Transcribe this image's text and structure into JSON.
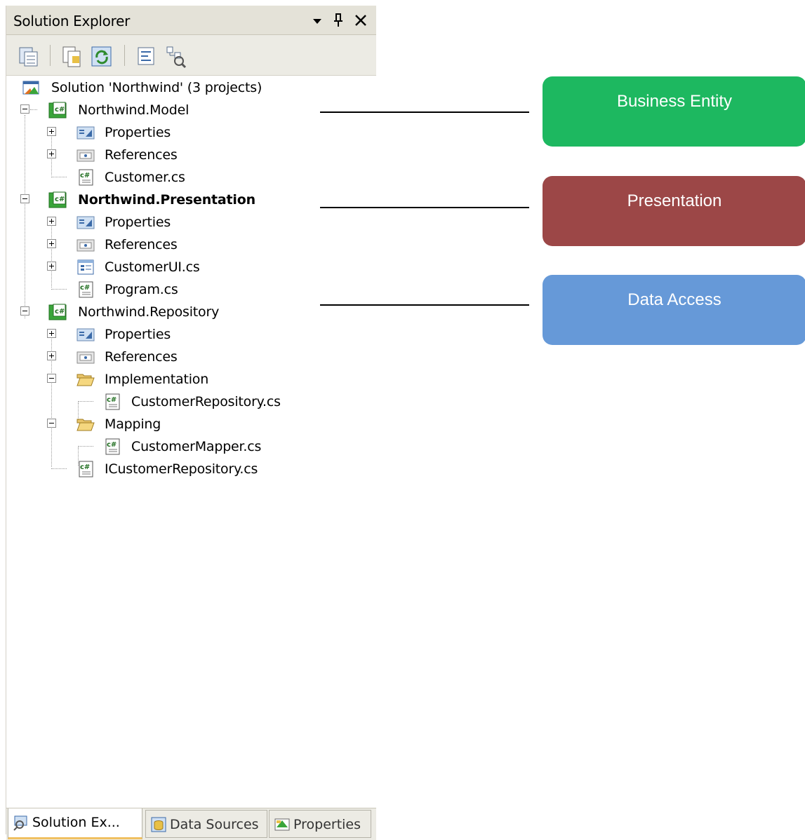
{
  "panel": {
    "title": "Solution Explorer",
    "title_buttons": [
      "dropdown-arrow-icon",
      "pin-icon",
      "close-icon"
    ],
    "toolbar": [
      "show-all-files-icon",
      "properties-icon",
      "refresh-icon",
      "view-code-icon",
      "class-view-icon"
    ]
  },
  "tree": {
    "solution": "Solution 'Northwind' (3 projects)",
    "model": {
      "name": "Northwind.Model",
      "properties": "Properties",
      "references": "References",
      "customer": "Customer.cs"
    },
    "presentation": {
      "name": "Northwind.Presentation",
      "properties": "Properties",
      "references": "References",
      "customer_ui": "CustomerUI.cs",
      "program": "Program.cs"
    },
    "repository": {
      "name": "Northwind.Repository",
      "properties": "Properties",
      "references": "References",
      "implementation": "Implementation",
      "customer_repository": "CustomerRepository.cs",
      "mapping": "Mapping",
      "customer_mapper": "CustomerMapper.cs",
      "icustomer_repository": "ICustomerRepository.cs"
    }
  },
  "tabs": {
    "solution_explorer": "Solution Ex...",
    "data_sources": "Data Sources",
    "properties": "Properties"
  },
  "annotations": {
    "business_entity": {
      "label": "Business Entity",
      "color": "#1db860"
    },
    "presentation": {
      "label": "Presentation",
      "color": "#9c4747"
    },
    "data_access": {
      "label": "Data Access",
      "color": "#6699d8"
    }
  },
  "colors": {
    "titlebar": "#e4e2d8",
    "toolbar": "#ecebe4",
    "csharp_icon_green": "#3aa53a"
  }
}
